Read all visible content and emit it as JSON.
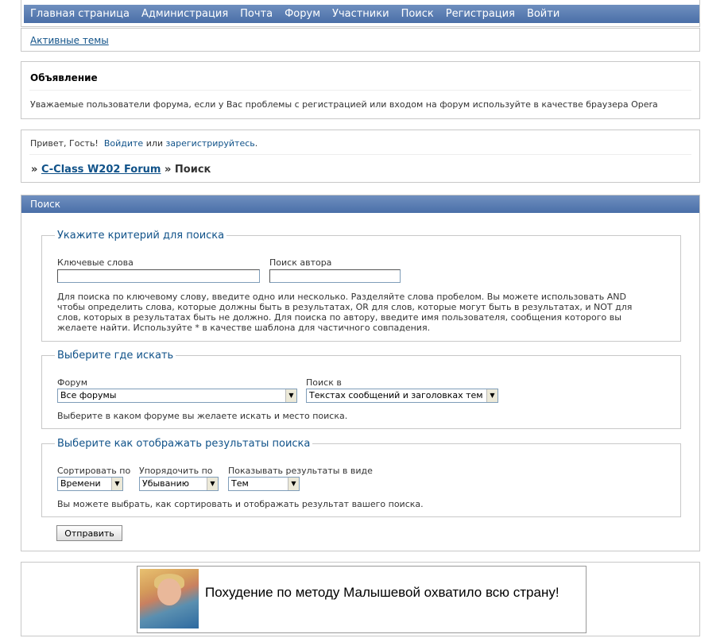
{
  "nav": {
    "items": [
      "Главная страница",
      "Администрация",
      "Почта",
      "Форум",
      "Участники",
      "Поиск",
      "Регистрация",
      "Войти"
    ]
  },
  "active_topics": "Активные темы",
  "announcement": {
    "title": "Объявление",
    "text": "Уважаемые пользователи форума, если у Вас проблемы с регистрацией или входом на форум используйте в качестве браузера Opera"
  },
  "greeting": {
    "prefix": "Привет, Гость!",
    "login": "Войдите",
    "or": "или",
    "register": "зарегистрируйтесь",
    "suffix": "."
  },
  "breadcrumb": {
    "sep": "»",
    "forum": "C-Class W202 Forum",
    "current": "Поиск"
  },
  "search": {
    "header": "Поиск",
    "criteria": {
      "legend": "Укажите критерий для поиска",
      "keywords_label": "Ключевые слова",
      "keywords_value": "",
      "author_label": "Поиск автора",
      "author_value": "",
      "help": "Для поиска по ключевому слову, введите одно или несколько. Разделяйте слова пробелом. Вы можете использовать AND чтобы определить слова, которые должны быть в результатах, OR для слов, которые могут быть в результатах, и NOT для слов, которых в результатах быть не должно. Для поиска по автору, введите имя пользователя, сообщения которого вы желаете найти. Используйте * в качестве шаблона для частичного совпадения."
    },
    "where": {
      "legend": "Выберите где искать",
      "forum_label": "Форум",
      "forum_value": "Все форумы",
      "searchin_label": "Поиск в",
      "searchin_value": "Текстах сообщений и заголовках тем",
      "help": "Выберите в каком форуме вы желаете искать и место поиска."
    },
    "display": {
      "legend": "Выберите как отображать результаты поиска",
      "sort_label": "Сортировать по",
      "sort_value": "Времени",
      "order_label": "Упорядочить по",
      "order_value": "Убыванию",
      "show_label": "Показывать результаты в виде",
      "show_value": "Тем",
      "help": "Вы можете выбрать, как сортировать и отображать результат вашего поиска."
    },
    "submit": "Отправить"
  },
  "ad": {
    "text": "Похудение по методу Малышевой охватило всю страну!"
  },
  "colors": {
    "nav_bg": "#5a7db3",
    "link": "#105289",
    "legend": "#105289"
  }
}
